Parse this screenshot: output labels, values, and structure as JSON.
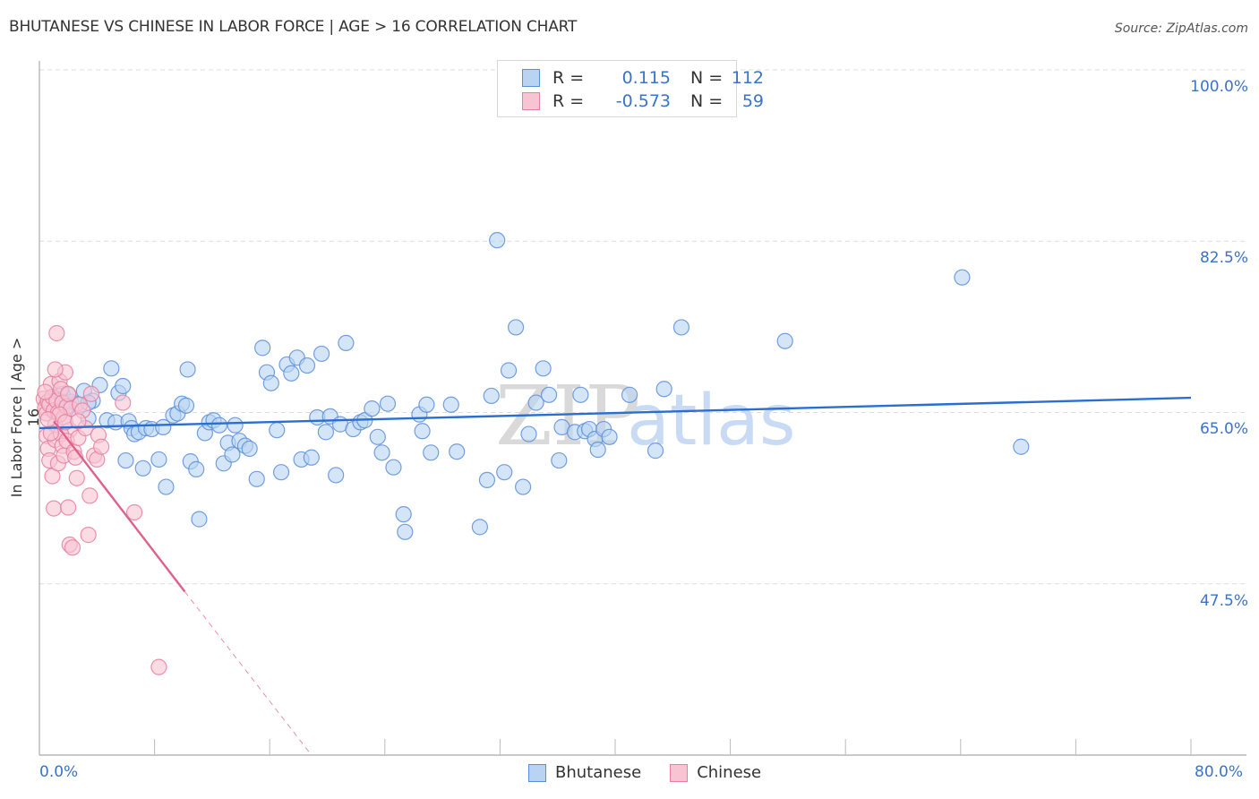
{
  "header": {
    "title": "BHUTANESE VS CHINESE IN LABOR FORCE | AGE > 16 CORRELATION CHART",
    "source": "Source: ZipAtlas.com"
  },
  "legend": {
    "rows": [
      {
        "r_label": "R =",
        "r_value": "0.115",
        "n_label": "N =",
        "n_value": "112"
      },
      {
        "r_label": "R =",
        "r_value": "-0.573",
        "n_label": "N =",
        "n_value": "59"
      }
    ]
  },
  "colors": {
    "bhutanese_fill": "#b9d3f3",
    "bhutanese_stroke": "#5b8fd9",
    "bhutanese_line": "#2a6fd0",
    "chinese_fill": "#f8c4d4",
    "chinese_stroke": "#e87fa0",
    "chinese_line": "#e0608c",
    "axis_label": "#3a73c9",
    "watermark_zip": "#d9d9d9",
    "watermark_atlas": "#c9dbf4"
  },
  "watermark": {
    "part1": "ZIP",
    "part2": "atlas"
  },
  "chart_data": {
    "type": "scatter",
    "title": "BHUTANESE VS CHINESE IN LABOR FORCE | AGE > 16 CORRELATION CHART",
    "xlabel": "",
    "ylabel": "In Labor Force | Age > 16",
    "xlim": [
      0,
      80
    ],
    "ylim": [
      30,
      100
    ],
    "x_tick_labels": [
      "0.0%",
      "80.0%"
    ],
    "y_ticks": [
      100,
      82.5,
      65,
      47.5
    ],
    "y_tick_labels": [
      "100.0%",
      "82.5%",
      "65.0%",
      "47.5%"
    ],
    "grid": true,
    "legend_position": "top-center",
    "series": [
      {
        "name": "Bhutanese",
        "R": 0.115,
        "N": 112,
        "trend": {
          "x": [
            0,
            80
          ],
          "y": [
            63.4,
            66.5
          ],
          "dashed_from": null
        },
        "points": [
          [
            0.8,
            65.8
          ],
          [
            1.2,
            66.4
          ],
          [
            1.6,
            66.9
          ],
          [
            1.9,
            65.4
          ],
          [
            2.2,
            66.1
          ],
          [
            2.6,
            65.9
          ],
          [
            3.1,
            67.2
          ],
          [
            3.4,
            64.4
          ],
          [
            3.7,
            66.2
          ],
          [
            4.2,
            67.8
          ],
          [
            4.7,
            64.2
          ],
          [
            5.0,
            69.5
          ],
          [
            5.3,
            64.0
          ],
          [
            5.5,
            67.0
          ],
          [
            5.8,
            67.7
          ],
          [
            6.0,
            60.1
          ],
          [
            6.2,
            64.1
          ],
          [
            6.4,
            63.4
          ],
          [
            6.6,
            62.8
          ],
          [
            6.9,
            63.0
          ],
          [
            7.2,
            59.3
          ],
          [
            7.4,
            63.4
          ],
          [
            7.8,
            63.3
          ],
          [
            8.3,
            60.2
          ],
          [
            8.8,
            57.4
          ],
          [
            8.6,
            63.5
          ],
          [
            9.3,
            64.7
          ],
          [
            9.6,
            64.9
          ],
          [
            9.9,
            65.9
          ],
          [
            10.2,
            65.7
          ],
          [
            10.3,
            69.4
          ],
          [
            10.5,
            60.0
          ],
          [
            10.9,
            59.2
          ],
          [
            11.1,
            54.1
          ],
          [
            11.5,
            62.9
          ],
          [
            11.8,
            64.0
          ],
          [
            12.1,
            64.2
          ],
          [
            12.5,
            63.7
          ],
          [
            12.8,
            59.8
          ],
          [
            13.1,
            61.9
          ],
          [
            13.4,
            60.7
          ],
          [
            13.6,
            63.7
          ],
          [
            13.9,
            62.1
          ],
          [
            14.3,
            61.6
          ],
          [
            14.6,
            61.3
          ],
          [
            15.1,
            58.2
          ],
          [
            15.5,
            71.6
          ],
          [
            15.8,
            69.1
          ],
          [
            16.1,
            68.0
          ],
          [
            16.5,
            63.2
          ],
          [
            16.8,
            58.9
          ],
          [
            17.2,
            69.9
          ],
          [
            17.5,
            69.0
          ],
          [
            17.9,
            70.6
          ],
          [
            18.2,
            60.2
          ],
          [
            18.6,
            69.8
          ],
          [
            18.9,
            60.4
          ],
          [
            19.3,
            64.5
          ],
          [
            19.6,
            71.0
          ],
          [
            19.9,
            63.0
          ],
          [
            20.2,
            64.6
          ],
          [
            20.6,
            58.6
          ],
          [
            20.9,
            63.8
          ],
          [
            21.3,
            72.1
          ],
          [
            21.8,
            63.3
          ],
          [
            22.3,
            64.0
          ],
          [
            22.6,
            64.2
          ],
          [
            23.1,
            65.4
          ],
          [
            23.5,
            62.5
          ],
          [
            23.8,
            60.9
          ],
          [
            24.2,
            65.9
          ],
          [
            24.6,
            59.4
          ],
          [
            25.3,
            54.6
          ],
          [
            25.4,
            52.8
          ],
          [
            26.4,
            64.8
          ],
          [
            26.6,
            63.1
          ],
          [
            26.9,
            65.8
          ],
          [
            27.2,
            60.9
          ],
          [
            28.6,
            65.8
          ],
          [
            29.0,
            61.0
          ],
          [
            30.6,
            53.3
          ],
          [
            31.1,
            58.1
          ],
          [
            31.4,
            66.7
          ],
          [
            31.8,
            82.6
          ],
          [
            32.3,
            58.9
          ],
          [
            32.6,
            69.3
          ],
          [
            33.1,
            73.7
          ],
          [
            33.6,
            57.4
          ],
          [
            34.0,
            62.8
          ],
          [
            34.5,
            66.0
          ],
          [
            35.0,
            69.5
          ],
          [
            35.4,
            66.8
          ],
          [
            36.1,
            60.1
          ],
          [
            36.3,
            63.5
          ],
          [
            37.2,
            63.0
          ],
          [
            37.6,
            66.8
          ],
          [
            37.9,
            63.1
          ],
          [
            38.2,
            63.3
          ],
          [
            38.6,
            62.3
          ],
          [
            38.8,
            61.2
          ],
          [
            39.2,
            63.3
          ],
          [
            39.6,
            62.5
          ],
          [
            41.0,
            66.8
          ],
          [
            42.8,
            61.1
          ],
          [
            43.4,
            67.4
          ],
          [
            44.6,
            73.7
          ],
          [
            51.8,
            72.3
          ],
          [
            64.1,
            78.8
          ],
          [
            68.2,
            61.5
          ],
          [
            1.0,
            65.1
          ],
          [
            2.0,
            66.8
          ],
          [
            3.4,
            66.0
          ]
        ]
      },
      {
        "name": "Chinese",
        "R": -0.573,
        "N": 59,
        "trend": {
          "x": [
            1.0,
            10.1,
            18.9
          ],
          "y": [
            64.1,
            46.7,
            30.0
          ],
          "dashed_from": 10.1
        },
        "points": [
          [
            0.3,
            66.4
          ],
          [
            0.4,
            65.5
          ],
          [
            0.5,
            64.9
          ],
          [
            0.6,
            66.1
          ],
          [
            0.7,
            65.8
          ],
          [
            0.8,
            67.9
          ],
          [
            0.9,
            66.6
          ],
          [
            1.0,
            65.2
          ],
          [
            1.1,
            63.7
          ],
          [
            1.2,
            66.2
          ],
          [
            1.3,
            65.0
          ],
          [
            1.4,
            68.2
          ],
          [
            1.5,
            67.4
          ],
          [
            1.6,
            66.0
          ],
          [
            1.7,
            64.5
          ],
          [
            1.8,
            69.1
          ],
          [
            1.9,
            65.6
          ],
          [
            2.0,
            66.9
          ],
          [
            2.1,
            63.2
          ],
          [
            2.2,
            65.4
          ],
          [
            0.5,
            62.6
          ],
          [
            0.6,
            61.3
          ],
          [
            0.7,
            60.1
          ],
          [
            0.9,
            58.5
          ],
          [
            1.0,
            55.2
          ],
          [
            1.1,
            62.2
          ],
          [
            1.2,
            73.1
          ],
          [
            1.3,
            59.8
          ],
          [
            1.4,
            64.8
          ],
          [
            1.5,
            62.8
          ],
          [
            1.6,
            61.6
          ],
          [
            1.7,
            60.6
          ],
          [
            1.8,
            64.0
          ],
          [
            1.9,
            62.1
          ],
          [
            2.0,
            55.3
          ],
          [
            2.1,
            51.5
          ],
          [
            2.3,
            51.2
          ],
          [
            2.4,
            61.0
          ],
          [
            2.5,
            60.4
          ],
          [
            2.6,
            58.3
          ],
          [
            2.7,
            62.4
          ],
          [
            2.8,
            65.8
          ],
          [
            3.0,
            65.2
          ],
          [
            3.2,
            63.4
          ],
          [
            3.4,
            52.5
          ],
          [
            3.5,
            56.5
          ],
          [
            3.6,
            66.9
          ],
          [
            3.8,
            60.6
          ],
          [
            4.0,
            60.2
          ],
          [
            4.1,
            62.7
          ],
          [
            4.3,
            61.5
          ],
          [
            0.4,
            67.1
          ],
          [
            0.8,
            62.9
          ],
          [
            1.1,
            69.4
          ],
          [
            2.7,
            64.1
          ],
          [
            5.8,
            66.0
          ],
          [
            6.6,
            54.8
          ],
          [
            8.3,
            39.0
          ],
          [
            0.6,
            64.3
          ]
        ]
      }
    ]
  }
}
